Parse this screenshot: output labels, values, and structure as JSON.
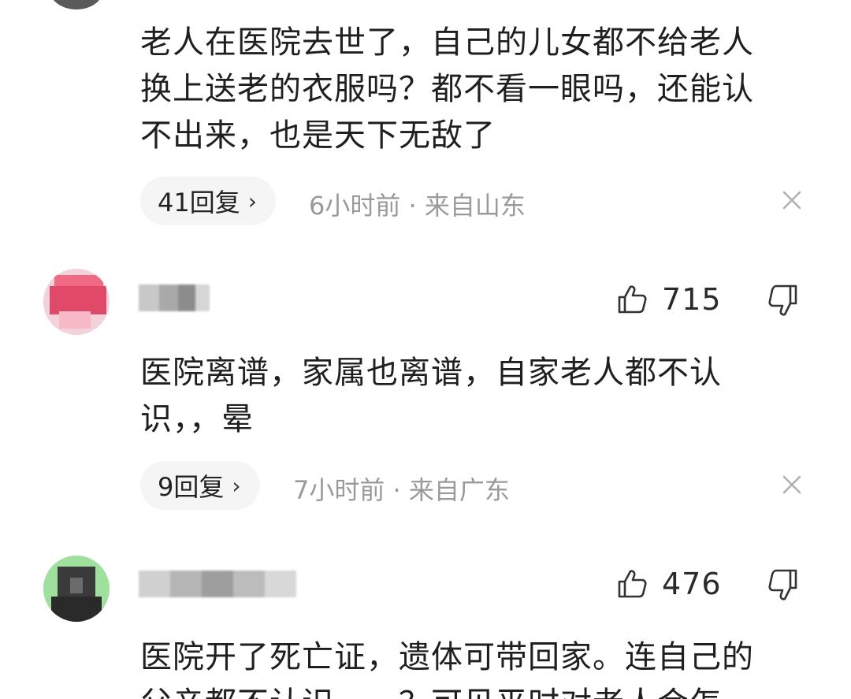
{
  "comments": [
    {
      "text": "老人在医院去世了，自己的儿女都不给老人\n换上送老的衣服吗？都不看一眼吗，还能认\n不出来，也是天下无敌了",
      "replies": "41回复",
      "time": "6小时前",
      "location": "来自山东"
    },
    {
      "likes": "715",
      "text": "医院离谱，家属也离谱，自家老人都不认\n识，，晕",
      "replies": "9回复",
      "time": "7小时前",
      "location": "来自广东"
    },
    {
      "likes": "476",
      "text": "医院开了死亡证，遗体可带回家。连自己的\n父亲都不认识……？可见平时对老人会怎"
    }
  ],
  "ui": {
    "separator": " · ",
    "chevron": "›",
    "icons": {
      "like": "thumbs-up-icon",
      "dislike": "thumbs-down-icon",
      "close": "close-icon"
    },
    "colors": {
      "text": "#1f1f1f",
      "meta": "#9a9a9a",
      "pill": "#f5f5f5",
      "icon": "#333333"
    }
  }
}
